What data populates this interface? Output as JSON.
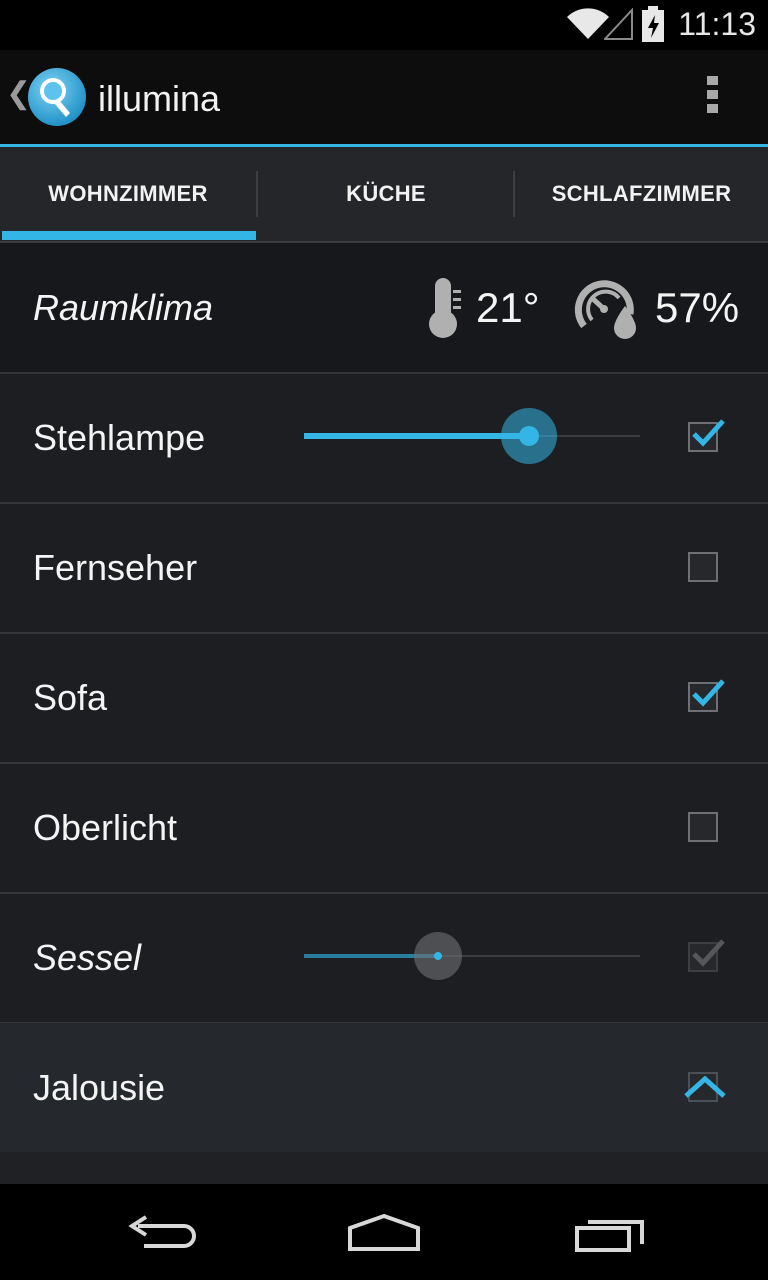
{
  "status_bar": {
    "time": "11:13",
    "icons": [
      "wifi-icon",
      "signal-icon",
      "battery-charging-icon"
    ]
  },
  "action_bar": {
    "up_icon": "chevron-left-icon",
    "app_icon": "lightbulb-icon",
    "title": "illumina",
    "overflow_icon": "overflow-menu-icon"
  },
  "tabs": [
    {
      "label": "WOHNZIMMER",
      "selected": true
    },
    {
      "label": "KÜCHE",
      "selected": false
    },
    {
      "label": "SCHLAFZIMMER",
      "selected": false
    }
  ],
  "climate": {
    "label": "Raumklima",
    "temperature": "21°",
    "temperature_icon": "thermometer-icon",
    "humidity": "57%",
    "humidity_icon": "humidity-gauge-icon"
  },
  "devices": [
    {
      "label": "Stehlampe",
      "checked": true,
      "slider": 0.67,
      "enabled": true
    },
    {
      "label": "Fernseher",
      "checked": false
    },
    {
      "label": "Sofa",
      "checked": true
    },
    {
      "label": "Oberlicht",
      "checked": false
    },
    {
      "label": "Sessel",
      "checked": true,
      "slider": 0.4,
      "enabled": false
    },
    {
      "label": "Jalousie",
      "control": "chevron-up-icon"
    }
  ],
  "nav_bar": {
    "icons": [
      "back-icon",
      "home-icon",
      "recent-apps-icon"
    ]
  },
  "colors": {
    "accent": "#33b5e5",
    "background": "#1c1e21"
  }
}
